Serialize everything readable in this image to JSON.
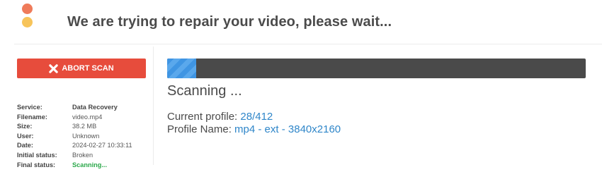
{
  "header": {
    "title": "We are trying to repair your video, please wait..."
  },
  "sidebar": {
    "abort_label": "ABORT SCAN",
    "info": [
      {
        "key": "Service:",
        "value": "Data Recovery"
      },
      {
        "key": "Filename:",
        "value": "video.mp4"
      },
      {
        "key": "Size:",
        "value": "38.2 MB"
      },
      {
        "key": "User:",
        "value": "Unknown"
      },
      {
        "key": "Date:",
        "value": "2024-02-27 10:33:11"
      },
      {
        "key": "Initial status:",
        "value": "Broken"
      },
      {
        "key": "Final status:",
        "value": "Scanning..."
      }
    ]
  },
  "main": {
    "progress_fraction": 0.07,
    "status_text": "Scanning ...",
    "current_profile_label": "Current profile:",
    "current_profile_value": "28/412",
    "profile_name_label": "Profile Name:",
    "profile_name_value": "mp4 - ext - 3840x2160"
  },
  "colors": {
    "accent_blue": "#2f86c9",
    "abort_red": "#e74c3c",
    "scanning_green": "#2ba84a",
    "progress_track": "#4a4a4a"
  }
}
